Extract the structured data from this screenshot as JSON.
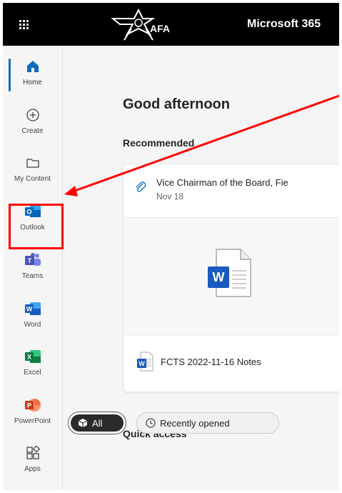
{
  "header": {
    "logo_text": "AFA",
    "brand": "Microsoft 365"
  },
  "rail": {
    "items": [
      {
        "label": "Home",
        "icon": "home-icon"
      },
      {
        "label": "Create",
        "icon": "plus-circle-icon"
      },
      {
        "label": "My Content",
        "icon": "folder-icon"
      },
      {
        "label": "Outlook",
        "icon": "outlook-icon"
      },
      {
        "label": "Teams",
        "icon": "teams-icon"
      },
      {
        "label": "Word",
        "icon": "word-icon"
      },
      {
        "label": "Excel",
        "icon": "excel-icon"
      },
      {
        "label": "PowerPoint",
        "icon": "powerpoint-icon"
      },
      {
        "label": "Apps",
        "icon": "apps-icon"
      }
    ]
  },
  "main": {
    "greeting": "Good afternoon",
    "recommended_heading": "Recommended",
    "card": {
      "title": "Vice Chairman of the Board, Fie",
      "date": "Nov 18",
      "file_name": "FCTS 2022-11-16 Notes"
    },
    "quick_access_heading": "Quick access",
    "filters": {
      "all": "All",
      "recent": "Recently opened"
    }
  },
  "colors": {
    "accent": "#0f6cbd",
    "annotation": "#ff0000",
    "topbar": "#000000",
    "word": "#185abd",
    "excel": "#107c41",
    "powerpoint": "#c43e1c",
    "teams": "#5b5fc7"
  }
}
